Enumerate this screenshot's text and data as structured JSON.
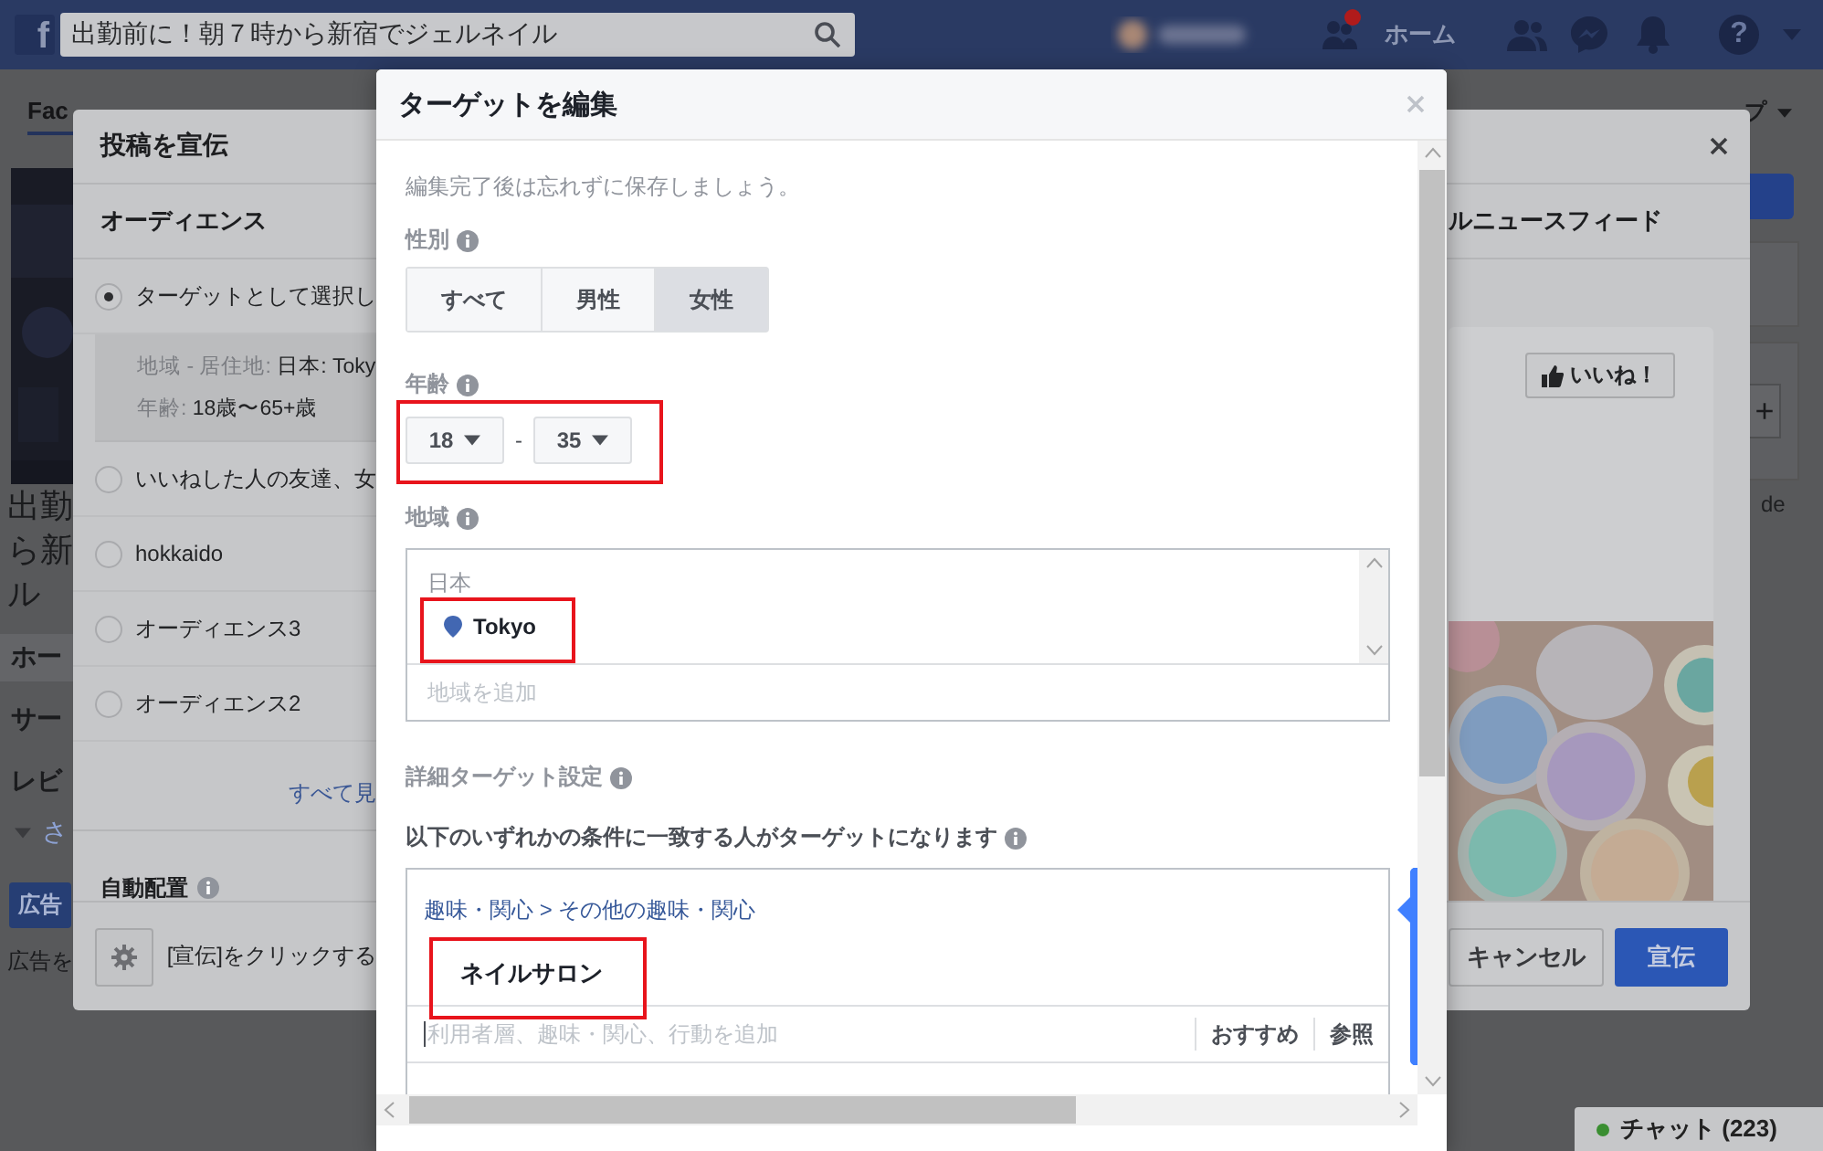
{
  "topbar": {
    "logo": "f",
    "search": {
      "value": "出勤前に！朝７時から新宿でジェルネイル"
    },
    "friend_requests": {
      "badge": true
    },
    "home": "ホーム",
    "help": "?"
  },
  "page": {
    "tab": "Fac",
    "right_tab": "プ",
    "title_lines": [
      "出勤",
      "ら新",
      "ル"
    ],
    "menu": [
      {
        "label": "ホー",
        "selected": true
      },
      {
        "label": "サー",
        "selected": false
      },
      {
        "label": "レビ",
        "selected": false
      }
    ],
    "more": "さ",
    "ad_button": "広告",
    "ad_note": "広告を",
    "add": "+",
    "side_note": "de"
  },
  "chat": {
    "label": "チャット (223)"
  },
  "promote_dialog": {
    "title": "投稿を宣伝",
    "audience_header": "オーディエンス",
    "audiences": [
      {
        "label": "ターゲットとして選択し",
        "selected": true,
        "details": [
          {
            "key": "地域 - 居住地:",
            "value": "日本: Toky"
          },
          {
            "key": "年齢:",
            "value": "18歳〜65+歳"
          }
        ]
      },
      {
        "label": "いいねした人の友達、女",
        "selected": false
      },
      {
        "label": "hokkaido",
        "selected": false
      },
      {
        "label": "オーディエンス3",
        "selected": false
      },
      {
        "label": "オーディエンス2",
        "selected": false
      }
    ],
    "see_all": "すべて見",
    "placement": "自動配置",
    "footer_note": "[宣伝]をクリックする",
    "placement_header": "ルニュースフィード",
    "like_button": "いいね！",
    "cancel": "キャンセル",
    "promote": "宣伝"
  },
  "target_dialog": {
    "title": "ターゲットを編集",
    "hint": "編集完了後は忘れずに保存しましょう。",
    "gender": {
      "label": "性別",
      "options": [
        {
          "label": "すべて",
          "selected": false
        },
        {
          "label": "男性",
          "selected": false
        },
        {
          "label": "女性",
          "selected": true
        }
      ]
    },
    "age": {
      "label": "年齢",
      "min": "18",
      "separator": "-",
      "max": "35",
      "highlighted": true
    },
    "location": {
      "label": "地域",
      "country": "日本",
      "items": [
        {
          "name": "Tokyo",
          "highlighted": true
        }
      ],
      "placeholder": "地域を追加"
    },
    "detailed": {
      "label": "詳細ターゲット設定",
      "rule": "以下のいずれかの条件に一致する人がターゲットになります",
      "category": "趣味・関心 > その他の趣味・関心",
      "items": [
        {
          "name": "ネイルサロン",
          "highlighted": true
        }
      ],
      "placeholder": "利用者層、趣味・関心、行動を追加",
      "suggest": "おすすめ",
      "browse": "参照"
    }
  }
}
